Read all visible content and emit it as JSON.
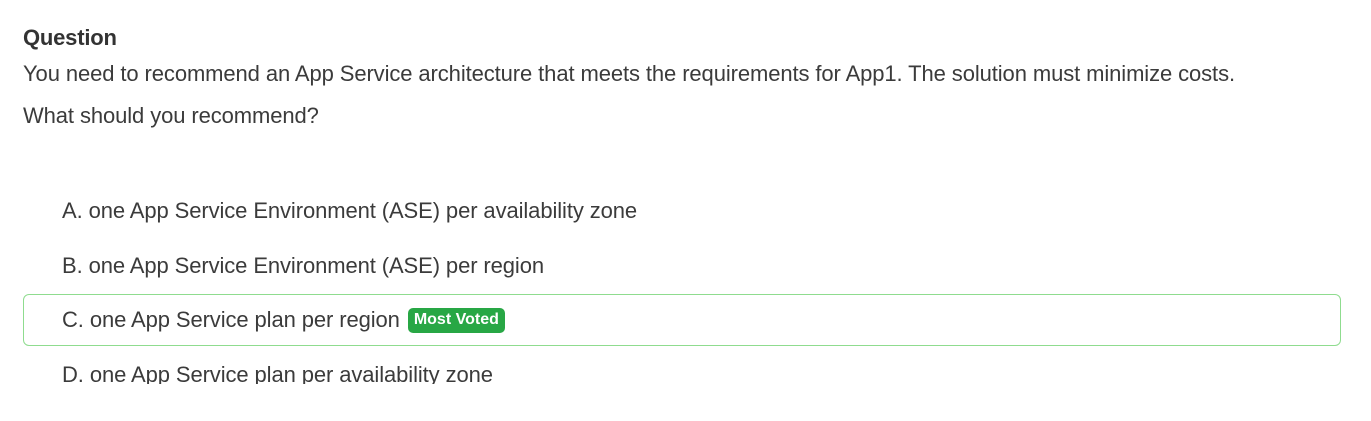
{
  "question": {
    "heading": "Question",
    "line1": "You need to recommend an App Service architecture that meets the requirements for App1. The solution must minimize costs.",
    "line2": "What should you recommend?"
  },
  "choices": [
    {
      "letter": "A.",
      "text": "one App Service Environment (ASE) per availability zone"
    },
    {
      "letter": "B.",
      "text": "one App Service Environment (ASE) per region"
    },
    {
      "letter": "C.",
      "text": "one App Service plan per region",
      "badge": "Most Voted"
    },
    {
      "letter": "D.",
      "text": "one App Service plan per availability zone"
    }
  ],
  "colors": {
    "badge_bg": "#28a745",
    "correct_border": "#8fdc8f",
    "text": "#3b3b3b"
  }
}
